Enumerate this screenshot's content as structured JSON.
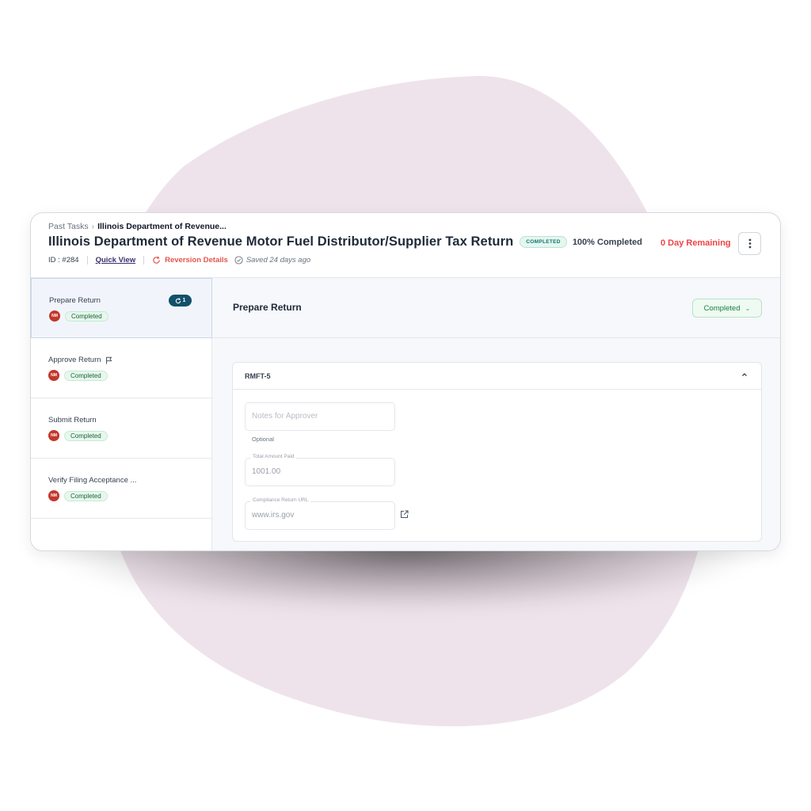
{
  "breadcrumb": {
    "parent": "Past Tasks",
    "current": "Illinois Department of Revenue..."
  },
  "task": {
    "title": "Illinois Department of Revenue Motor Fuel Distributor/Supplier Tax Return",
    "status_badge": "COMPLETED",
    "progress_text": "100% Completed",
    "id_text": "ID : #284",
    "quick_view": "Quick View",
    "reversion_details": "Reversion Details",
    "saved_text": "Saved 24 days ago",
    "remaining_text": "0 Day Remaining"
  },
  "steps": [
    {
      "label": "Prepare Return",
      "avatar": "NM",
      "status": "Completed",
      "active": true,
      "revision_count": "1"
    },
    {
      "label": "Approve Return",
      "avatar": "NM",
      "status": "Completed",
      "flag": true
    },
    {
      "label": "Submit Return",
      "avatar": "NM",
      "status": "Completed"
    },
    {
      "label": "Verify Filing Acceptance ...",
      "avatar": "NM",
      "status": "Completed"
    }
  ],
  "main": {
    "title": "Prepare Return",
    "status_select": "Completed",
    "panel_title": "RMFT-5",
    "fields": {
      "notes_placeholder": "Notes for Approver",
      "notes_helper": "Optional",
      "amount_label": "Total Amount Paid",
      "amount_value": "1001.00",
      "url_label": "Compliance Return URL",
      "url_value": "www.irs.gov"
    }
  },
  "colors": {
    "blob": "#efe3eb",
    "accent_red": "#ef4444",
    "avatar": "#c2372b",
    "revision_badge": "#14506b",
    "completed_green": "#15803d"
  },
  "icons": [
    "chevron-right-icon",
    "reversion-icon",
    "saved-check-icon",
    "kebab-menu-icon",
    "flag-icon",
    "chevron-down-icon",
    "chevron-up-icon",
    "external-link-icon"
  ]
}
